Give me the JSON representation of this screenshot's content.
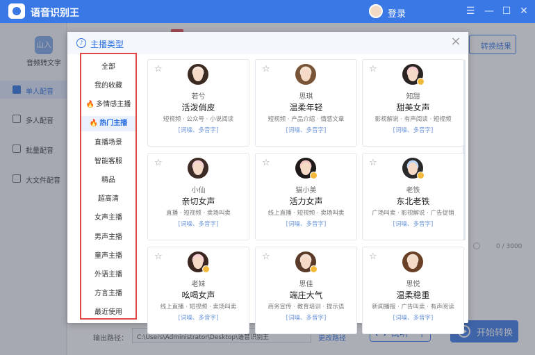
{
  "app": {
    "title": "语音识别王",
    "login": "登录"
  },
  "sidebar": {
    "top_label": "音频转文字",
    "top_icon_text": "山入",
    "items": [
      {
        "label": "单人配音",
        "active": true
      },
      {
        "label": "多人配音",
        "active": false
      },
      {
        "label": "批量配音",
        "active": false
      },
      {
        "label": "大文件配音",
        "active": false
      }
    ]
  },
  "background": {
    "result_button": "转换结果",
    "counter": "0 / 3000",
    "output_label": "输出路径：",
    "output_path": "C:\\Users\\Administrator\\Desktop\\语音识别王",
    "change_path": "更改路径",
    "trial_button": "试听一下",
    "start_button": "开始转换"
  },
  "modal": {
    "title": "主播类型",
    "categories": [
      {
        "label": "全部",
        "fire": false,
        "active": false
      },
      {
        "label": "我的收藏",
        "fire": false,
        "active": false
      },
      {
        "label": "多情感主播",
        "fire": true,
        "active": false
      },
      {
        "label": "热门主播",
        "fire": true,
        "active": true
      },
      {
        "label": "直播场景",
        "fire": false,
        "active": false
      },
      {
        "label": "智能客服",
        "fire": false,
        "active": false
      },
      {
        "label": "精品",
        "fire": false,
        "active": false
      },
      {
        "label": "超高清",
        "fire": false,
        "active": false
      },
      {
        "label": "女声主播",
        "fire": false,
        "active": false
      },
      {
        "label": "男声主播",
        "fire": false,
        "active": false
      },
      {
        "label": "童声主播",
        "fire": false,
        "active": false
      },
      {
        "label": "外语主播",
        "fire": false,
        "active": false
      },
      {
        "label": "方言主播",
        "fire": false,
        "active": false
      },
      {
        "label": "最近使用",
        "fire": false,
        "active": false
      }
    ],
    "cards": [
      {
        "nick": "若兮",
        "style": "活泼俏皮",
        "tags": "短视频 · 公众号 · 小说阅读",
        "features": "[词噪、多音字]",
        "premium": false,
        "hair": "#3b2a22",
        "bg": "#f6e6da"
      },
      {
        "nick": "思琪",
        "style": "温柔年轻",
        "tags": "短视频 · 产品介绍 · 情感文章",
        "features": "[词噪、多音字]",
        "premium": false,
        "hair": "#7a5436",
        "bg": "#f3e2d3"
      },
      {
        "nick": "知甜",
        "style": "甜美女声",
        "tags": "影视解说 · 有声阅读 · 短视频",
        "features": "[词噪、多音字]",
        "premium": true,
        "hair": "#2a2423",
        "bg": "#f5c9cf"
      },
      {
        "nick": "小仙",
        "style": "亲切女声",
        "tags": "直播 · 短视频 · 卖场叫卖",
        "features": "[词噪、多音字]",
        "premium": false,
        "hair": "#3d2b26",
        "bg": "#f7d3d8"
      },
      {
        "nick": "猫小美",
        "style": "活力女声",
        "tags": "线上直播 · 短视频 · 卖场叫卖",
        "features": "[词噪、多音字]",
        "premium": true,
        "hair": "#1f1a1a",
        "bg": "#f4c7c3"
      },
      {
        "nick": "老铁",
        "style": "东北老铁",
        "tags": "广场叫卖 · 影视解说 · 广告促销",
        "features": "[词噪、多音字]",
        "premium": true,
        "hair": "#2a2a2a",
        "bg": "#bfd7f4"
      },
      {
        "nick": "老妹",
        "style": "吆喝女声",
        "tags": "线上直播 · 短视频 · 卖场叫卖",
        "features": "[词噪、多音字]",
        "premium": true,
        "hair": "#3a2620",
        "bg": "#f6cfd2"
      },
      {
        "nick": "思佳",
        "style": "端庄大气",
        "tags": "商务宣传 · 教育培训 · 提示语",
        "features": "[词噪、多音字]",
        "premium": true,
        "hair": "#5a3a28",
        "bg": "#f2e1d2"
      },
      {
        "nick": "思悦",
        "style": "温柔稳重",
        "tags": "新闻播报 · 广告叫卖 · 有声阅读",
        "features": "[词噪、多音字]",
        "premium": false,
        "hair": "#6a4026",
        "bg": "#f1dfd0"
      }
    ]
  }
}
